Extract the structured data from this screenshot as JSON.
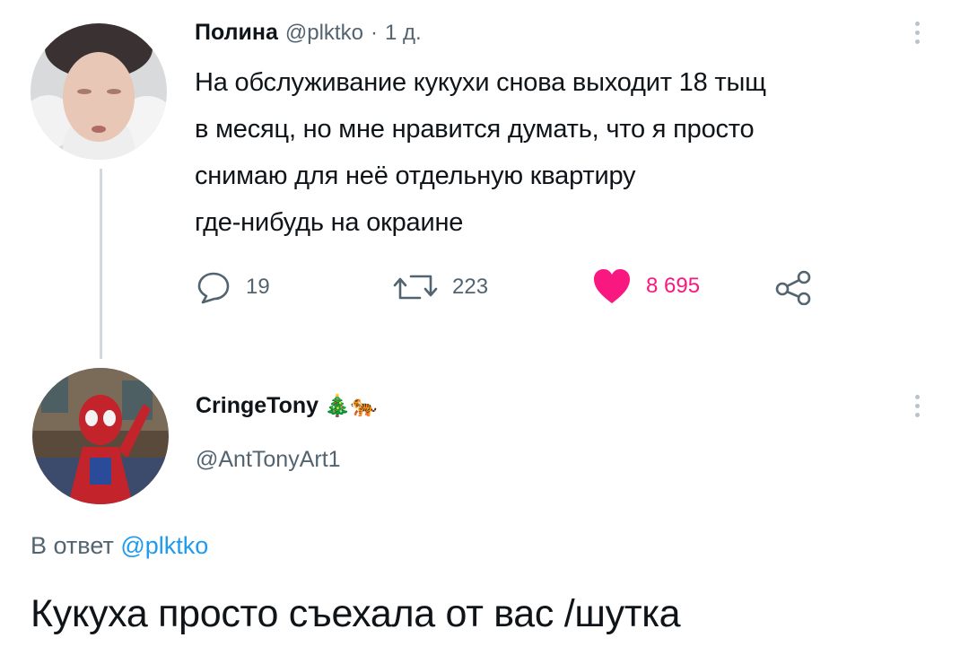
{
  "tweet": {
    "author_name": "Полина",
    "handle": "@plktko",
    "separator": "·",
    "time": "1 д.",
    "text_lines": [
      "На обслуживание кукухи снова выходит 18 тыщ",
      "в месяц, но мне нравится думать, что я просто",
      "снимаю для неё отдельную квартиру",
      "где-нибудь на окраине"
    ],
    "actions": {
      "replies": "19",
      "retweets": "223",
      "likes": "8 695"
    },
    "icons": {
      "reply": "speech-bubble-icon",
      "retweet": "retweet-icon",
      "like": "heart-icon",
      "share": "share-icon",
      "more": "vertical-dots-icon"
    },
    "colors": {
      "like_active": "#f91880"
    }
  },
  "reply": {
    "author_name": "CringeTony",
    "emoji": "🎄🐅",
    "handle": "@AntTonyArt1",
    "reply_to_prefix": "В ответ",
    "reply_to_handle": "@plktko",
    "text": "Кукуха просто съехала от вас /шутка",
    "colors": {
      "link": "#1d9bf0"
    }
  }
}
